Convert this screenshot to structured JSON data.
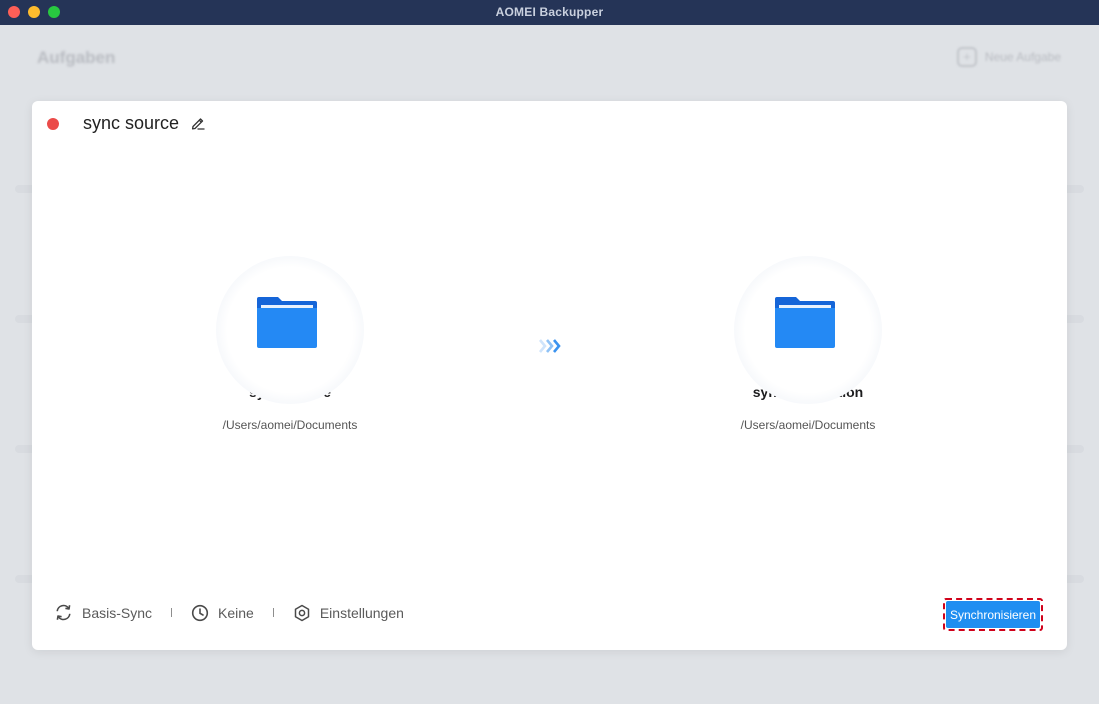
{
  "window": {
    "title": "AOMEI Backupper"
  },
  "background": {
    "heading": "Aufgaben",
    "new_task_label": "Neue Aufgabe",
    "new_task_icon": "plus-icon"
  },
  "dialog": {
    "task_name": "sync source",
    "status_color": "#eb4b49",
    "source": {
      "title": "sync source",
      "path": "/Users/aomei/Documents",
      "icon": "folder-icon"
    },
    "destination": {
      "title": "sync destination",
      "path": "/Users/aomei/Documents",
      "icon": "folder-icon"
    },
    "direction_icon": "triple-chevron-right-icon",
    "footer": {
      "mode_label": "Basis-Sync",
      "schedule_label": "Keine",
      "settings_label": "Einstellungen"
    },
    "sync_button_label": "Synchronisieren",
    "accent_color": "#1f8ef1",
    "highlight_color": "#d0021b"
  }
}
